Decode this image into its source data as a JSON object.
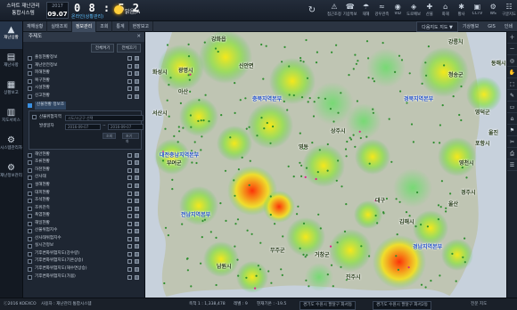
{
  "app": {
    "title_line1": "스마트 재난관리",
    "title_line2": "통합시스템",
    "date_year": "2017",
    "date_md": "09.07",
    "clock": "0 8 : 5 2",
    "clock_sub": "온라인(상황관리)",
    "weather_text": "맑음/A"
  },
  "toolbar": [
    {
      "icon": "⚠",
      "label": "접근조정"
    },
    {
      "icon": "☎",
      "label": "기상특보"
    },
    {
      "icon": "☂",
      "label": "재해"
    },
    {
      "icon": "≈",
      "label": "강우관측"
    },
    {
      "icon": "◉",
      "label": "VID"
    },
    {
      "icon": "◈",
      "label": "도로예보"
    },
    {
      "icon": "✚",
      "label": "산불"
    },
    {
      "icon": "⌂",
      "label": "화재"
    },
    {
      "icon": "✱",
      "label": "황사"
    },
    {
      "icon": "▣",
      "label": "CCTV"
    },
    {
      "icon": "⚙",
      "label": "WS"
    },
    {
      "icon": "☷",
      "label": "구글지도"
    }
  ],
  "leftnav": [
    {
      "icon": "▲",
      "label": "재난상황"
    },
    {
      "icon": "▤",
      "label": "재난사항"
    },
    {
      "icon": "▦",
      "label": "상황보고"
    },
    {
      "icon": "▥",
      "label": "지도서비스"
    },
    {
      "icon": "⚙",
      "label": "시스템관리자"
    },
    {
      "icon": "⚙",
      "label": "재난정보관리"
    }
  ],
  "tabs": [
    {
      "label": "재해상황"
    },
    {
      "label": "실태조회"
    },
    {
      "label": "정보관리"
    },
    {
      "label": "조회"
    },
    {
      "label": "통계"
    },
    {
      "label": "현장보고"
    }
  ],
  "tabs_right": [
    {
      "label": "다음지도 지도 ▼"
    },
    {
      "label": "기상정보"
    },
    {
      "label": "GIS"
    },
    {
      "label": "인쇄"
    }
  ],
  "panel": {
    "title": "주제도",
    "btn_all_on": "전체켜기",
    "btn_all_off": "전체끄기",
    "layers_top": [
      {
        "label": "출동현황정보",
        "checked": false
      },
      {
        "label": "재난안전정보",
        "checked": false
      },
      {
        "label": "피해현황",
        "checked": false
      },
      {
        "label": "복구현황",
        "checked": false
      },
      {
        "label": "시설현황",
        "checked": false
      },
      {
        "label": "신고현황",
        "checked": false
      }
    ],
    "sub_header": "산불현황 정보조",
    "sub_group": "산불위험지역",
    "sub_select_placeholder": "시도/시군구 선택",
    "sub_period_label": "발생일자",
    "sub_date_from": "2016-09-07",
    "sub_date_to": "2016-09-07",
    "sub_btn1": "조회",
    "sub_btn2": "초기화",
    "layers_bottom": [
      {
        "label": "해안현황",
        "checked": false
      },
      {
        "label": "조류현황",
        "checked": false
      },
      {
        "label": "하천현황",
        "checked": false
      },
      {
        "label": "산사태",
        "checked": false
      },
      {
        "label": "설해현황",
        "checked": false
      },
      {
        "label": "대피현황",
        "checked": false
      },
      {
        "label": "조석현황",
        "checked": false
      },
      {
        "label": "조위관측",
        "checked": false
      },
      {
        "label": "폭염현황",
        "checked": false
      },
      {
        "label": "해일현황",
        "checked": false
      },
      {
        "label": "산불위험지수",
        "checked": false
      },
      {
        "label": "산사태위험지수",
        "checked": false
      },
      {
        "label": "실시간정보",
        "checked": false
      },
      {
        "label": "기후변화위험지도(강수량)",
        "checked": false
      },
      {
        "label": "기후변화위험지도(기온상승)",
        "checked": false
      },
      {
        "label": "기후변화위험지도(해수면상승)",
        "checked": false
      },
      {
        "label": "기후변화위험지도(가뭄)",
        "checked": false
      }
    ]
  },
  "map": {
    "labels": [
      {
        "text": "강화읍",
        "cls": "city"
      },
      {
        "text": "광명시",
        "cls": "city"
      },
      {
        "text": "화성시",
        "cls": "city"
      },
      {
        "text": "아산",
        "cls": "city"
      },
      {
        "text": "서산시",
        "cls": "city"
      },
      {
        "text": "신안면",
        "cls": "city"
      },
      {
        "text": "충북지역본부",
        "cls": "region"
      },
      {
        "text": "대전충남지역본부",
        "cls": "region"
      },
      {
        "text": "부여군",
        "cls": "city"
      },
      {
        "text": "영동",
        "cls": "city"
      },
      {
        "text": "상주시",
        "cls": "city"
      },
      {
        "text": "청송군",
        "cls": "city"
      },
      {
        "text": "영천시",
        "cls": "city"
      },
      {
        "text": "경주시",
        "cls": "city"
      },
      {
        "text": "대구",
        "cls": "city"
      },
      {
        "text": "울산",
        "cls": "city"
      },
      {
        "text": "포항시",
        "cls": "city"
      },
      {
        "text": "무주군",
        "cls": "city"
      },
      {
        "text": "남원시",
        "cls": "city"
      },
      {
        "text": "진주시",
        "cls": "city"
      },
      {
        "text": "거창군",
        "cls": "city"
      },
      {
        "text": "김해시",
        "cls": "city"
      },
      {
        "text": "영덕군",
        "cls": "city"
      },
      {
        "text": "전남지역본부",
        "cls": "region"
      },
      {
        "text": "경북지역본부",
        "cls": "region"
      },
      {
        "text": "경남지역본부",
        "cls": "region"
      },
      {
        "text": "강릉시",
        "cls": "city"
      },
      {
        "text": "동해시",
        "cls": "city"
      },
      {
        "text": "울진",
        "cls": "city"
      }
    ]
  },
  "righttools": [
    "＋",
    "－",
    "◎",
    "✋",
    "⬚",
    "✎",
    "▭",
    "⌂",
    "⚑",
    "✂",
    "⎙",
    "☰"
  ],
  "status": {
    "copyright": "ⓒ2016 KOEXCO",
    "system": "사용자 : 재난관리 통합시스템",
    "scale": "축척 1 : 1,338,478",
    "zoom": "레벨 : 9",
    "coords": "경도 : 127.43 / 위도 : 36.02",
    "weather_info": "현재기온 : -19.5",
    "weather2": "경기도 수원시 팔달구 화서동",
    "address": "경기도 수원시 팔달구 화서2동",
    "area": "전문 지도"
  }
}
